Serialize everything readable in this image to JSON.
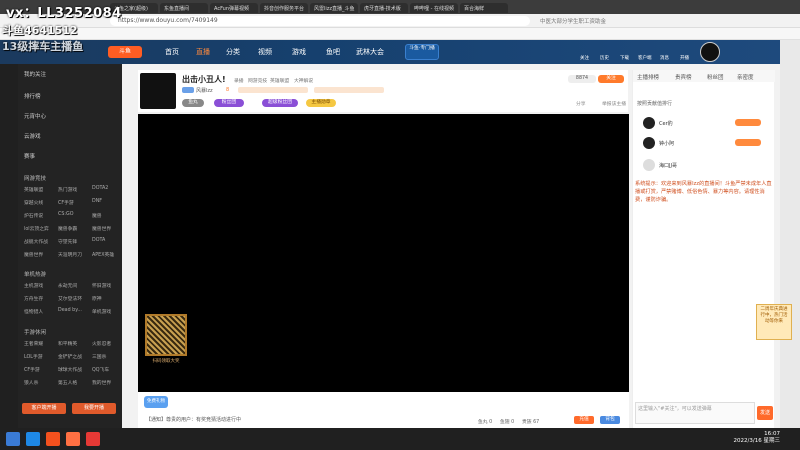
{
  "overlay": {
    "line1": "vx：LL3252084",
    "line2": "斗鱼4641512",
    "line3": "13级摔车主播鱼"
  },
  "browser": {
    "tabs": [
      "斗鱼之家(超级)",
      "东鱼直播间",
      "AcFun弹幕视频",
      "抖音创作服务平台",
      "风雷lizz直播_斗鱼",
      "虎牙直播-技术版",
      "哔哔哩 - 在线视频",
      "百合海鲜"
    ],
    "url": "https://www.douyu.com/7409149",
    "search_hint": "中医大部分学生职工资助金"
  },
  "site_nav": {
    "logo": "斗鱼",
    "items": [
      "首页",
      "直播",
      "分类",
      "视频",
      "游戏",
      "鱼吧",
      "武林大会"
    ],
    "promo": "斗鱼·专门播",
    "right_items": [
      "关注",
      "历史",
      "下载",
      "客户端",
      "消息",
      "开播"
    ]
  },
  "sidebar": {
    "items": [
      "我的关注",
      "排行榜",
      "元宵中心",
      "云游戏",
      "赛事"
    ],
    "sec1": "网游竞技",
    "games1": [
      "英雄联盟",
      "热门游戏",
      "DOTA2",
      "穿越火线",
      "CF手游",
      "DNF",
      "炉石传说",
      "CS:GO",
      "魔兽",
      "lol云顶之弈",
      "魔兽争霸",
      "魔兽世界",
      "战舰大作战",
      "守望先锋",
      "DOTA",
      "魔兽世界",
      "天涯明月刀",
      "APEX英雄"
    ],
    "sec2": "单机热游",
    "games2": [
      "主机游戏",
      "永劫无间",
      "怀旧游戏",
      "方舟生存",
      "艾尔登法环",
      "原神",
      "怪物猎人",
      "Dead by...",
      "单机游戏"
    ],
    "sec3": "手游休闲",
    "games3": [
      "王者荣耀",
      "和平精英",
      "火影忍者",
      "LOL手游",
      "金铲铲之战",
      "三国杀",
      "CF手游",
      "球球大作战",
      "QQ飞车",
      "狼人杀",
      "第五人格",
      "我的世界"
    ],
    "btn1": "客户端开播",
    "btn2": "我要开播"
  },
  "streamer": {
    "title": "出击小丑人!",
    "tags": [
      "录播",
      "网游竞技",
      "英雄联盟",
      "大神解说"
    ],
    "name": "风暴lzz",
    "level": "8",
    "hot": "8874",
    "share": "分享",
    "follow": "关注",
    "vip_label": "鱼丸",
    "badges": [
      "粉丝团",
      "超级粉丝团",
      "主播勋章"
    ],
    "report": "举报该主播"
  },
  "video": {
    "qr_caption": "扫码领取大奖"
  },
  "below_video": {
    "gift_label": "免费礼物",
    "notice": "【通知】尊贵的用户：有奖竞猜活动进行中",
    "bottom_stats": [
      "鱼丸 0",
      "鱼翅 0",
      "贵族 67",
      "充值",
      "背包"
    ]
  },
  "rpanel": {
    "tabs": [
      "主播排榜",
      "贵宾榜",
      "粉丝团",
      "亲密度"
    ],
    "rank_label": "按照贡献值排行",
    "rows": [
      {
        "name": "Cer豹"
      },
      {
        "name": "钟小阿"
      },
      {
        "name": "海口JJ哥"
      }
    ],
    "system_notice": "系统提示：欢迎来到风暴lzz的直播间！斗鱼严禁未成年人直播或打赏，严禁赌博、低俗色情、暴力等内容。请理性消费，谨防诈骗。",
    "side_promo": "二周年庆典进行中，热门活动等你来",
    "chat_placeholder": "这里输入\"#关注\"，可以发送弹幕",
    "send": "发送"
  },
  "taskbar": {
    "time": "16:07",
    "date": "2022/3/16 星期三"
  }
}
